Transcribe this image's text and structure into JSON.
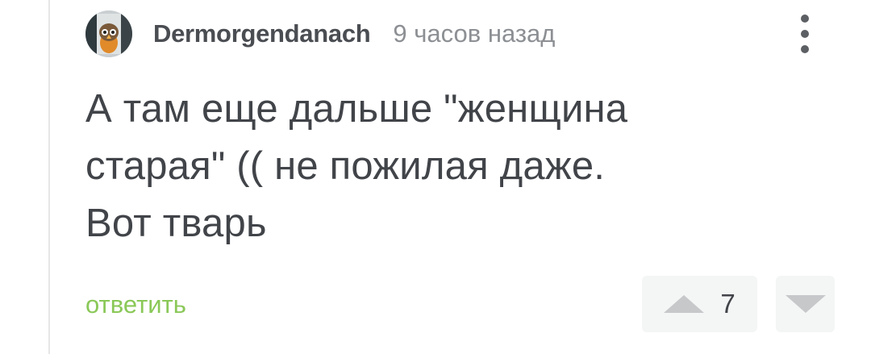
{
  "comment": {
    "author": "Dermorgendanach",
    "time_ago": "9 часов назад",
    "text_lines": [
      "А там еще дальше \"женщина",
      "старая\" (( не пожилая даже.",
      "Вот тварь"
    ],
    "reply_label": "ответить",
    "rating": "7"
  },
  "colors": {
    "reply_green": "#8ac858",
    "text": "#414449",
    "muted": "#8c8f93",
    "vote_bg": "#f4f5f5",
    "vote_icon": "#c6c8ca"
  },
  "icons": {
    "avatar": "avatar-image",
    "menu": "more-vertical-icon",
    "upvote": "triangle-up-icon",
    "downvote": "triangle-down-icon"
  }
}
